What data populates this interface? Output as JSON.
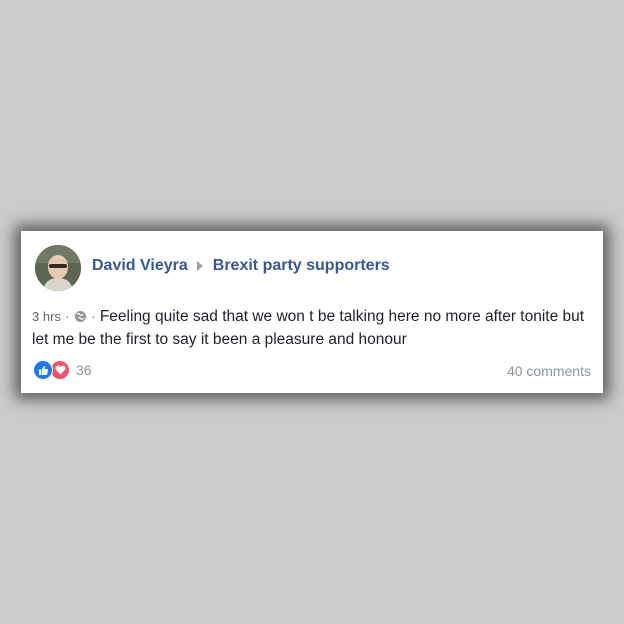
{
  "post": {
    "author": "David Vieyra",
    "group": "Brexit party supporters",
    "timestamp": "3 hrs",
    "separator": "·",
    "text": "Feeling quite sad that we won t be talking here no more after tonite but let me be the first to say it been a pleasure and honour",
    "reaction_count": "36",
    "comments": "40 comments",
    "icons": {
      "audience": "globe-icon",
      "reactions": [
        "like-icon",
        "love-icon"
      ]
    },
    "colors": {
      "link": "#365899",
      "like": "#2078f4",
      "love": "#f25268",
      "meta": "#616770"
    }
  }
}
